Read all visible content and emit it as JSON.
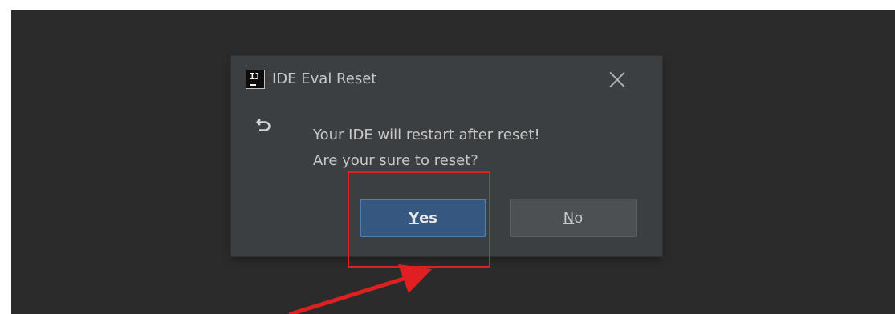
{
  "dialog": {
    "title": "IDE Eval Reset",
    "app_icon_text": "IJ",
    "message_line1": "Your IDE will restart after reset!",
    "message_line2": "Are your sure to reset?",
    "yes_button": {
      "mnemonic": "Y",
      "rest": "es"
    },
    "no_button": {
      "mnemonic": "N",
      "rest": "o"
    }
  },
  "icons": {
    "app": "intellij-idea-icon",
    "close": "close-icon",
    "info": "undo-arrow-icon"
  },
  "annotations": {
    "highlight_color": "#e02020",
    "arrow_color": "#e02020"
  },
  "colors": {
    "backdrop": "#2b2b2b",
    "dialog_bg": "#3c3f41",
    "primary_button": "#365880",
    "secondary_button": "#4c5052",
    "text": "#c8c8c8"
  }
}
